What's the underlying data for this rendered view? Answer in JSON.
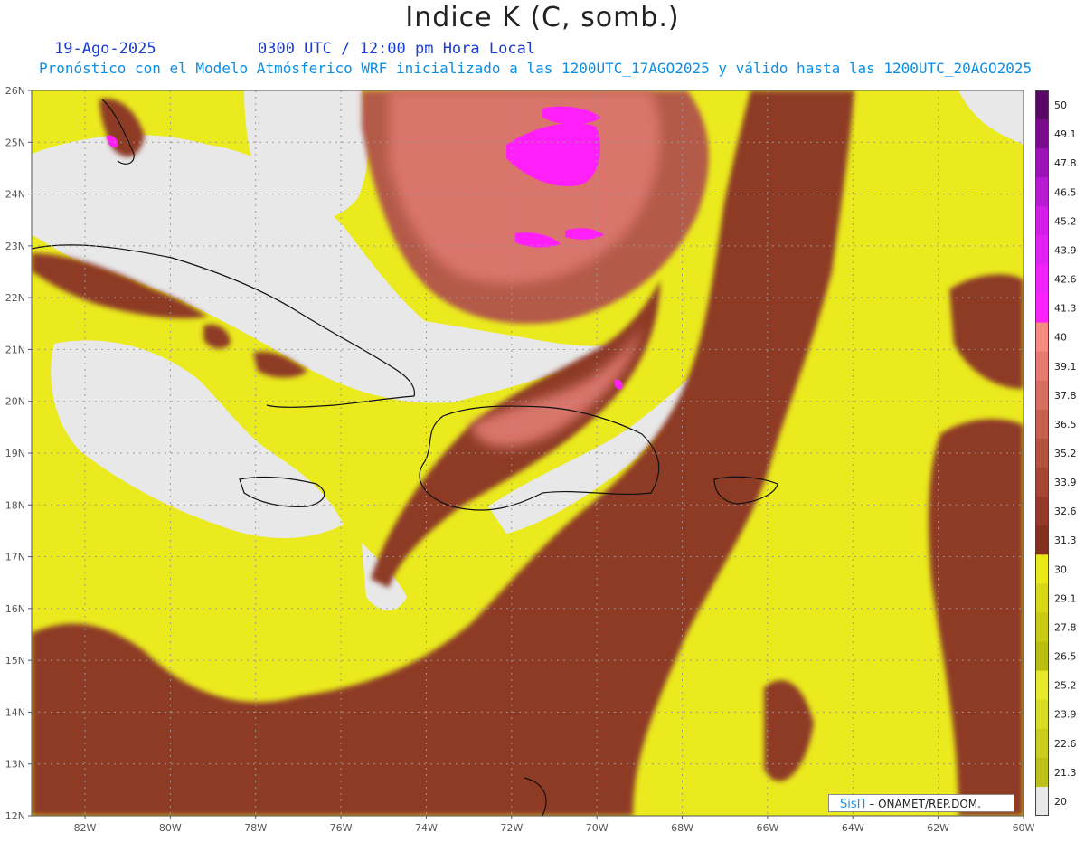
{
  "header": {
    "title": "Indice K (C, somb.)",
    "date": "19-Ago-2025",
    "time": "0300 UTC / 12:00 pm Hora Local",
    "model": "Pronóstico con el Modelo Atmósferico WRF inicializado a las 1200UTC_17AGO2025 y válido hasta las  1200UTC_20AGO2025"
  },
  "map": {
    "lat_labels": [
      "26N",
      "25N",
      "24N",
      "23N",
      "22N",
      "21N",
      "20N",
      "19N",
      "18N",
      "17N",
      "16N",
      "15N",
      "14N",
      "13N",
      "12N"
    ],
    "lon_labels": [
      "82W",
      "80W",
      "78W",
      "76W",
      "74W",
      "72W",
      "70W",
      "68W",
      "66W",
      "64W",
      "62W",
      "60W"
    ],
    "colors": {
      "no_data": "#e8e8e8",
      "yellow_band": "#eaea1e",
      "brown_low": "#8e3a28",
      "brown_mid": "#b45a48",
      "salmon": "#d9746a",
      "magenta": "#ff1ff8",
      "coast": "#111111",
      "grid": "#999999"
    }
  },
  "colorbar": {
    "labels": [
      "50",
      "49.1",
      "47.8",
      "46.5",
      "45.2",
      "43.9",
      "42.6",
      "41.3",
      "40",
      "39.1",
      "37.8",
      "36.5",
      "35.2",
      "33.9",
      "32.6",
      "31.3",
      "30",
      "29.1",
      "27.8",
      "26.5",
      "25.2",
      "23.9",
      "22.6",
      "21.3",
      "20"
    ],
    "colors": [
      "#5a0868",
      "#7a0a8e",
      "#9c12b8",
      "#b81ad4",
      "#d21ee6",
      "#e222f2",
      "#f024fa",
      "#fc22fc",
      "#f58a80",
      "#e77a70",
      "#d76e62",
      "#c8604f",
      "#b45240",
      "#a54534",
      "#96392a",
      "#84301f",
      "#e8e81a",
      "#d6d818",
      "#c8ca14",
      "#b9bd10",
      "#e6ea2a",
      "#d8dc24",
      "#cacd1e",
      "#bcc018",
      "#e8e8e8"
    ]
  },
  "credit": {
    "brand": "SisΠ",
    "org": "– ONAMET/REP.DOM."
  }
}
